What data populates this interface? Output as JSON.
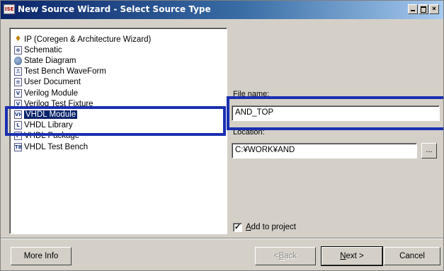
{
  "window": {
    "title": "New Source Wizard - Select Source Type",
    "app_icon_text": "ISE",
    "controls": {
      "minimize": "_",
      "maximize": "□",
      "close": "×"
    }
  },
  "source_types": [
    {
      "label": "IP (Coregen & Architecture Wizard)",
      "icon": "ip-wizard-icon",
      "icon_text": "♦"
    },
    {
      "label": "Schematic",
      "icon": "schematic-icon",
      "icon_text": "⊕"
    },
    {
      "label": "State Diagram",
      "icon": "state-diagram-icon",
      "icon_text": ""
    },
    {
      "label": "Test Bench WaveForm",
      "icon": "waveform-icon",
      "icon_text": "⎍"
    },
    {
      "label": "User Document",
      "icon": "document-icon",
      "icon_text": "≡"
    },
    {
      "label": "Verilog Module",
      "icon": "verilog-module-icon",
      "icon_text": "V"
    },
    {
      "label": "Verilog Test Fixture",
      "icon": "verilog-fixture-icon",
      "icon_text": "V"
    },
    {
      "label": "VHDL Module",
      "icon": "vhdl-module-icon",
      "icon_text": "VH",
      "selected": true
    },
    {
      "label": "VHDL Library",
      "icon": "vhdl-library-icon",
      "icon_text": "L"
    },
    {
      "label": "VHDL Package",
      "icon": "vhdl-package-icon",
      "icon_text": "P"
    },
    {
      "label": "VHDL Test Bench",
      "icon": "vhdl-testbench-icon",
      "icon_text": "TB"
    }
  ],
  "file_name": {
    "label": "File name:",
    "value": "AND_TOP"
  },
  "location": {
    "label": "Location:",
    "value": "C:¥WORK¥AND",
    "browse_label": "..."
  },
  "add_to_project": {
    "checked": true,
    "check_mark": "✓",
    "label_accel": "A",
    "label_rest": "dd to project"
  },
  "buttons": {
    "more_info": "More Info",
    "back_arrow": "< ",
    "back_accel": "B",
    "back_rest": "ack",
    "next_accel": "N",
    "next_rest": "ext >",
    "cancel": "Cancel"
  },
  "highlight_color": "#1a2fb0"
}
